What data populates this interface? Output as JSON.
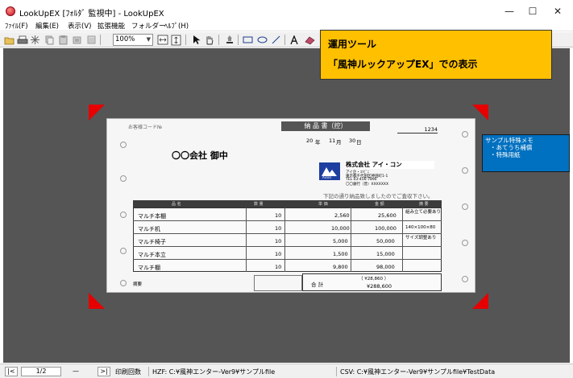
{
  "window": {
    "title": "LookUpEX [ﾌｫﾙﾀﾞ 監視中] - LookUpEX",
    "minimize_glyph": "—",
    "maximize_glyph": "☐",
    "close_glyph": "✕"
  },
  "menu": [
    "ﾌｧｲﾙ(F)",
    "編集(E)",
    "表示(V)",
    "拡張機能",
    "フォルダー",
    "ﾍﾙﾌﾟ(H)"
  ],
  "toolbar": {
    "zoom_value": "100%"
  },
  "callout": {
    "line1": "運用ツール",
    "line2": "「風神ルックアップEX」での表示"
  },
  "memo": {
    "title": "サンプル特殊メモ",
    "item1": "・あてうち補償",
    "item2": "・特殊用紙"
  },
  "document": {
    "form_no": "お客様コード№",
    "title": "納 品 書（控）",
    "number": "1234",
    "date_year": "20",
    "date_year_unit": "年",
    "date_month": "11",
    "date_month_unit": "月",
    "date_day": "30",
    "date_day_unit": "日",
    "recipient": "〇〇会社 御中",
    "company": "株式会社 アイ・コン",
    "company_sub": "アイ企・ｺﾝﾋﾞﾆ",
    "company_addr": "東京都千代田区神田町1-1",
    "company_tel": "TEL 03-456-7890",
    "company_bank": "〇〇銀行（普）XXXXXXX",
    "logo_text": "Aicon",
    "message": "下記の通り納品致しましたのでご査収下さい。",
    "headers": [
      "品 名",
      "数 量",
      "単 価",
      "金 額",
      "摘 要"
    ],
    "rows": [
      {
        "name": "マルチ本棚",
        "qty": "10",
        "price": "2,560",
        "amount": "25,600",
        "note": "組み立て必要あり"
      },
      {
        "name": "マルチ机",
        "qty": "10",
        "price": "10,000",
        "amount": "100,000",
        "note": "140×100×80"
      },
      {
        "name": "マルチ椅子",
        "qty": "10",
        "price": "5,000",
        "amount": "50,000",
        "note": "サイズ調整あり"
      },
      {
        "name": "マルチ本立",
        "qty": "10",
        "price": "1,500",
        "amount": "15,000",
        "note": ""
      },
      {
        "name": "マルチ棚",
        "qty": "10",
        "price": "9,800",
        "amount": "98,000",
        "note": ""
      }
    ],
    "remarks_label": "摘要",
    "total_label": "合 計",
    "tax_label": "（ ¥28,860 ）",
    "total_value": "¥288,600"
  },
  "status": {
    "first_btn": "|<",
    "page": "1/2",
    "dash": "—",
    "last_btn": ">|",
    "print_count": "印刷回数",
    "hzf": "HZF: C:¥風神エンター-Ver9¥サンプルfile",
    "csv": "CSV: C:¥風神エンター-Ver9¥サンプルfile¥TestData"
  },
  "colors": {
    "workspace": "#555555",
    "callout": "#ffc000",
    "memo": "#0070c0",
    "corner": "#e60000"
  }
}
